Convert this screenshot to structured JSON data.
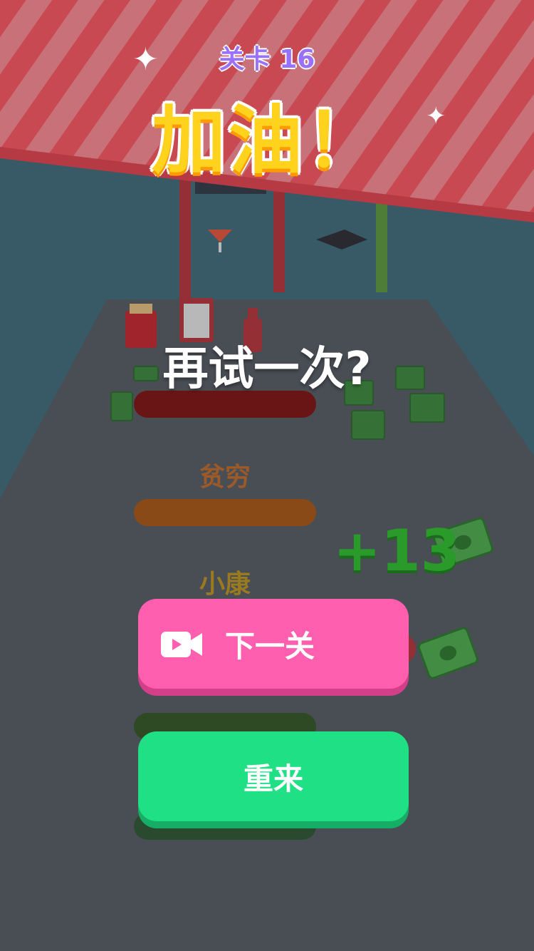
{
  "banner": {
    "level_label": "关卡 16",
    "cheer_title": "加油！"
  },
  "dialog": {
    "question": "再试一次?"
  },
  "wealth_tiers": [
    {
      "label": "",
      "color": "#6a1515"
    },
    {
      "label": "贫穷",
      "color": "#8a4a18"
    },
    {
      "label": "小康",
      "color": "#8a6a10"
    },
    {
      "label": "",
      "color": "#2e4a24"
    },
    {
      "label": "",
      "color": "#2a4a30"
    }
  ],
  "pickup": {
    "bonus_text": "+13"
  },
  "buttons": {
    "next_level_label": "下一关",
    "next_level_icon": "video-camera-icon",
    "retry_label": "重来"
  },
  "colors": {
    "banner_red": "#ff5560",
    "banner_stripe": "#ff8a92",
    "title_yellow": "#ffd21e",
    "level_purple": "#9a70ff",
    "next_button": "#ff5fae",
    "retry_button": "#20e085"
  }
}
